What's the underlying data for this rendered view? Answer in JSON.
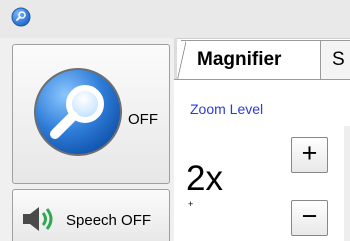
{
  "titlebar": {
    "icon": "magnifier-icon"
  },
  "left_panel": {
    "magnifier_toggle": {
      "icon": "magnifier-icon",
      "state_label": "OFF",
      "accent": "#2f7dd8"
    },
    "speech_toggle": {
      "icon": "speaker-icon",
      "label": "Speech OFF",
      "accent": "#2fa84f"
    }
  },
  "tabs": [
    {
      "label": "Magnifier",
      "active": true
    },
    {
      "label": "S",
      "active": false
    }
  ],
  "magnifier": {
    "zoom_title": "Zoom Level",
    "zoom_value": "2x",
    "increase_label": "+",
    "decrease_label": "−"
  },
  "colors": {
    "zoom_title": "#2b3cd8",
    "tab_border": "#9a9a9a"
  }
}
